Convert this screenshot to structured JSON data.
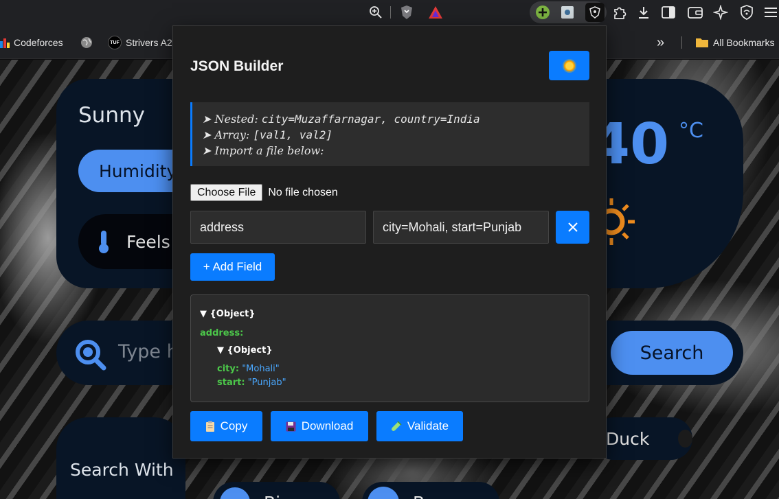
{
  "browser": {
    "bookmarks": [
      {
        "label": "Codeforces"
      },
      {
        "label": ""
      },
      {
        "label": "Strivers A2"
      },
      {
        "label": "All Bookmarks"
      }
    ],
    "overflow_label": "»"
  },
  "background_page": {
    "weather_condition": "Sunny",
    "humidity_label": "Humidity",
    "feels_label": "Feels",
    "temperature": "40",
    "temp_unit": "°C",
    "search_placeholder": "Type h",
    "search_button": "Search",
    "search_with_label": "Search With",
    "duck_label": "Duck",
    "chip_b_label": "Bi",
    "chip_c_label": "Br"
  },
  "popup": {
    "title": "JSON Builder",
    "help": {
      "line1_prefix": "➤ Nested: ",
      "line1_code": "city=Muzaffarnagar, country=India",
      "line2_prefix": "➤ Array: ",
      "line2_code": "[val1, val2]",
      "line3": "➤ Import a file below:"
    },
    "file_input": {
      "button": "Choose File",
      "status": "No file chosen"
    },
    "field": {
      "key": "address",
      "value": "city=Mohali, start=Punjab"
    },
    "add_field_label": "+ Add Field",
    "preview": {
      "root_label": "▼ {Object}",
      "key_address": "address:",
      "nested_label": "▼ {Object}",
      "city_key": "city:",
      "city_value": "\"Mohali\"",
      "start_key": "start:",
      "start_value": "\"Punjab\""
    },
    "actions": {
      "copy": "Copy",
      "download": "Download",
      "validate": "Validate"
    }
  }
}
